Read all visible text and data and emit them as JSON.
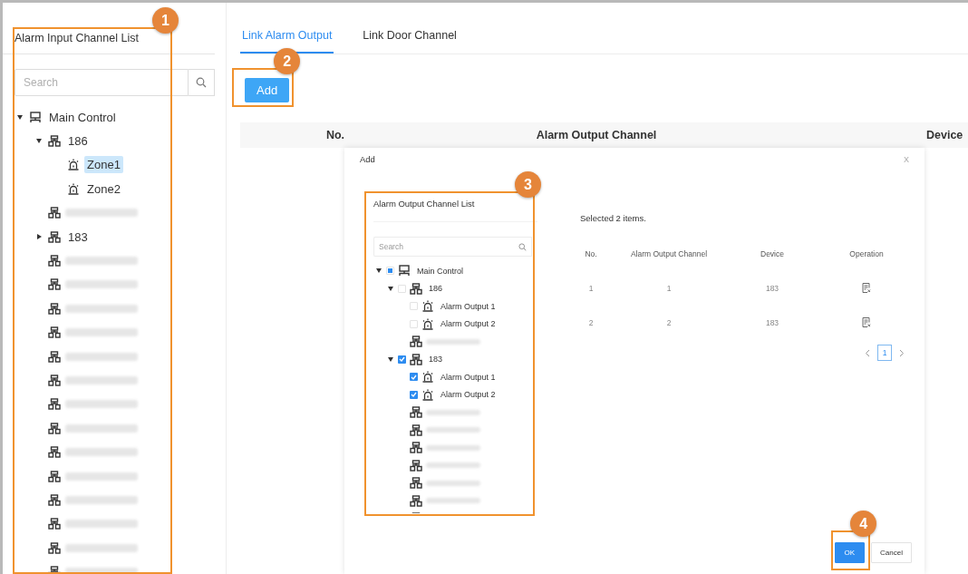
{
  "left_panel": {
    "title": "Alarm Input Channel List",
    "search": {
      "placeholder": "Search"
    },
    "tree": [
      {
        "label": "Main Control",
        "kind": "control",
        "expanded": true,
        "selected": false,
        "children": [
          {
            "label": "186",
            "kind": "device",
            "expanded": true,
            "selected": false,
            "children": [
              {
                "label": "Zone1",
                "kind": "zone",
                "selected": true
              },
              {
                "label": "Zone2",
                "kind": "zone",
                "selected": false
              }
            ]
          },
          {
            "kind": "device"
          },
          {
            "label": "183",
            "kind": "device",
            "expanded": false,
            "selected": false
          },
          {
            "kind": "device"
          },
          {
            "kind": "device"
          },
          {
            "kind": "device"
          },
          {
            "kind": "device"
          },
          {
            "kind": "device"
          },
          {
            "kind": "device"
          },
          {
            "kind": "device"
          },
          {
            "kind": "device"
          },
          {
            "kind": "device"
          },
          {
            "kind": "device"
          },
          {
            "kind": "device"
          },
          {
            "kind": "device"
          },
          {
            "kind": "device"
          },
          {
            "kind": "device"
          }
        ]
      }
    ]
  },
  "tabs": [
    {
      "label": "Link Alarm Output",
      "selected": true
    },
    {
      "label": "Link Door Channel",
      "selected": false
    }
  ],
  "add_button": "Add",
  "table": {
    "columns": [
      "No.",
      "Alarm Output Channel",
      "Device"
    ]
  },
  "dialog": {
    "title": "Add",
    "close": "X",
    "channel_list": {
      "title": "Alarm Output Channel List",
      "search": {
        "placeholder": "Search"
      },
      "tree": [
        {
          "label": "Main Control",
          "kind": "control",
          "expanded": true,
          "checked": false,
          "indeterminate": true,
          "children": [
            {
              "label": "186",
              "kind": "device",
              "expanded": true,
              "checked": false,
              "children": [
                {
                  "label": "Alarm Output 1",
                  "kind": "zone",
                  "checked": false
                },
                {
                  "label": "Alarm Output 2",
                  "kind": "zone",
                  "checked": false
                }
              ]
            },
            {
              "kind": "device"
            },
            {
              "label": "183",
              "kind": "device",
              "expanded": true,
              "checked": true,
              "children": [
                {
                  "label": "Alarm Output 1",
                  "kind": "zone",
                  "checked": true
                },
                {
                  "label": "Alarm Output 2",
                  "kind": "zone",
                  "checked": true
                }
              ]
            },
            {
              "kind": "device"
            },
            {
              "kind": "device"
            },
            {
              "kind": "device"
            },
            {
              "kind": "device"
            },
            {
              "kind": "device"
            },
            {
              "kind": "device"
            },
            {
              "kind": "device"
            }
          ]
        }
      ]
    },
    "summary": "Selected 2 items.",
    "table": {
      "columns": [
        "No.",
        "Alarm Output Channel",
        "Device",
        "Operation"
      ],
      "rows": [
        {
          "no": "1",
          "channel": "1",
          "device": "183"
        },
        {
          "no": "2",
          "channel": "2",
          "device": "183"
        }
      ]
    },
    "pagination": {
      "pages": [
        {
          "label": "1",
          "selected": true
        }
      ]
    },
    "buttons": [
      {
        "label": "OK",
        "kind": "primary"
      },
      {
        "label": "Cancel",
        "kind": "secondary"
      }
    ]
  },
  "annotations": [
    {
      "label": "1"
    },
    {
      "label": "2"
    },
    {
      "label": "3"
    },
    {
      "label": "4"
    }
  ]
}
